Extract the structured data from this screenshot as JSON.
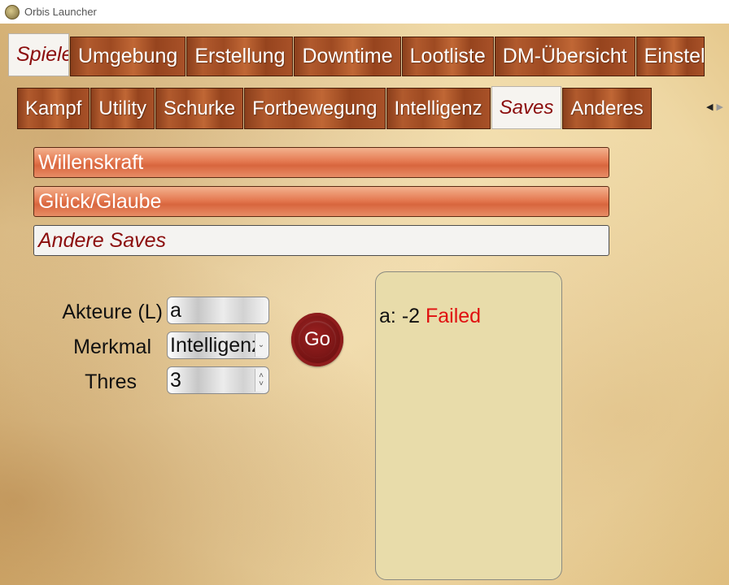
{
  "window": {
    "title": "Orbis Launcher"
  },
  "main_tabs": [
    "Spieler",
    "Umgebung",
    "Erstellung",
    "Downtime",
    "Lootliste",
    "DM-Übersicht",
    "Einstellungen"
  ],
  "sub_tabs": [
    "Kampf",
    "Utility",
    "Schurke",
    "Fortbewegung",
    "Intelligenz",
    "Saves",
    "Anderes"
  ],
  "sections": [
    "Willenskraft",
    "Glück/Glaube",
    "Andere Saves"
  ],
  "form": {
    "actors_label": "Akteure (L)",
    "actors_value": "a",
    "attribute_label": "Merkmal",
    "attribute_value": "Intelligenz",
    "thres_label": "Thres",
    "thres_value": "3",
    "go_label": "Go"
  },
  "output": {
    "name": "a:",
    "value": "-2",
    "status": "Failed"
  },
  "colors": {
    "fail": "#e01010",
    "active_tab_text": "#8b0d0d"
  }
}
